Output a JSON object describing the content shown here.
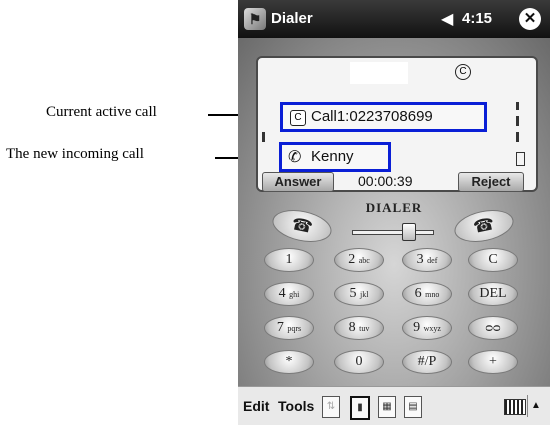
{
  "annotations": {
    "current_call": "Current active call",
    "incoming_call": "The new incoming call"
  },
  "titlebar": {
    "title": "Dialer",
    "time": "4:15",
    "start_icon": "windows-flag-icon",
    "volume_icon": "speaker-icon",
    "close_icon": "close-icon"
  },
  "display": {
    "call1": "Call1:0223708699",
    "call2": "Kenny",
    "timer": "00:00:39",
    "answer_label": "Answer",
    "reject_label": "Reject"
  },
  "brand": "DIALER",
  "keypad": {
    "rows": [
      [
        {
          "num": "1",
          "sub": ""
        },
        {
          "num": "2",
          "sub": "abc"
        },
        {
          "num": "3",
          "sub": "def"
        },
        {
          "num": "C",
          "sub": ""
        }
      ],
      [
        {
          "num": "4",
          "sub": "ghi"
        },
        {
          "num": "5",
          "sub": "jkl"
        },
        {
          "num": "6",
          "sub": "mno"
        },
        {
          "num": "DEL",
          "sub": ""
        }
      ],
      [
        {
          "num": "7",
          "sub": "pqrs"
        },
        {
          "num": "8",
          "sub": "tuv"
        },
        {
          "num": "9",
          "sub": "wxyz"
        },
        {
          "num": "ᴑᴑ",
          "sub": ""
        }
      ],
      [
        {
          "num": "*",
          "sub": ""
        },
        {
          "num": "0",
          "sub": ""
        },
        {
          "num": "#/P",
          "sub": ""
        },
        {
          "num": "+",
          "sub": ""
        }
      ]
    ]
  },
  "menubar": {
    "edit": "Edit",
    "tools": "Tools"
  },
  "colors": {
    "highlight": "#0a1fd6",
    "titlebar": "#1b1b1b"
  }
}
